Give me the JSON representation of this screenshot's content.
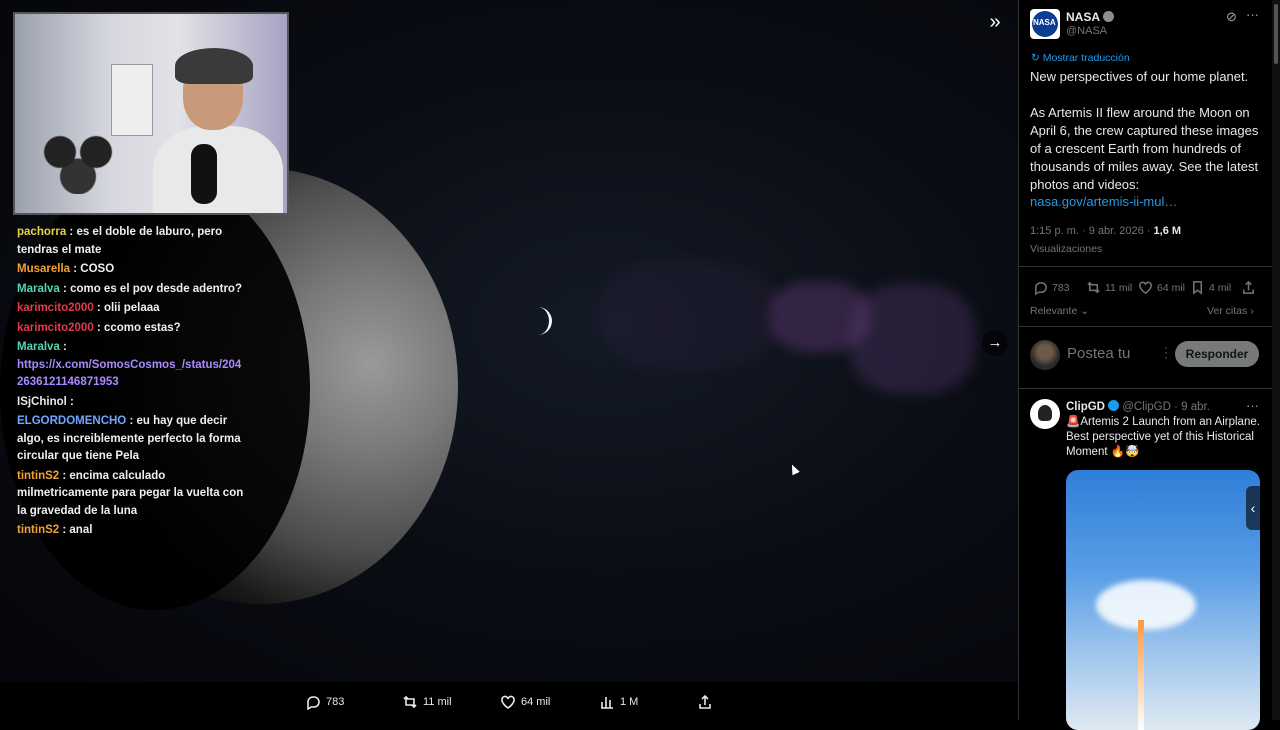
{
  "media_bar": {
    "replies": "783",
    "reposts": "11 mil",
    "likes": "64 mil",
    "views": "1 M"
  },
  "chat": {
    "messages": [
      {
        "user": "pachorra",
        "text": ": es el doble de laburo, pero tendras el mate",
        "user_color": "#e6d34a"
      },
      {
        "user": "Musarella",
        "text": ": COSO",
        "user_color": "#f0a23a"
      },
      {
        "user": "Maralva",
        "text": ": como es el pov desde adentro?",
        "user_color": "#58d3b4"
      },
      {
        "user": "karimcito2000",
        "text": ": olii pelaaa",
        "user_color": "#e23a4a"
      },
      {
        "user": "karimcito2000",
        "text": ": ccomo estas?",
        "user_color": "#e23a4a"
      },
      {
        "user": "Maralva",
        "text": ":",
        "user_color": "#58d3b4",
        "link": "https://x.com/SomosCosmos_/status/2042636121146871953"
      },
      {
        "user": "ISjChinol",
        "text": ":",
        "user_color": "#e7e9ea"
      },
      {
        "user": "ELGORDOMENCHO",
        "text": ": eu hay que decir algo, es increiblemente perfecto la forma circular que tiene Pela",
        "user_color": "#6ea8ff"
      },
      {
        "user": "tintinS2",
        "text": ": encima calculado milmetricamente para pegar la vuelta con la gravedad de la luna",
        "user_color": "#f0a23a"
      },
      {
        "user": "tintinS2",
        "text": ": anal",
        "user_color": "#f0a23a"
      }
    ]
  },
  "tweet": {
    "author": "NASA",
    "handle": "@NASA",
    "translate": "Mostrar traducción",
    "text1": "New perspectives of our home planet.",
    "text2": "As Artemis II flew around the Moon on April 6, the crew captured these images of a crescent Earth from hundreds of thousands of miles away. See the latest photos and videos:",
    "link": "nasa.gov/artemis-ii-mul…",
    "time": "1:15 p. m. · 9 abr. 2026 · ",
    "views_count": "1,6 M",
    "views_label": "Visualizaciones",
    "replies": "783",
    "reposts": "11 mil",
    "likes": "64 mil",
    "bookmarks": "4 mil",
    "sort": "Relevante",
    "quotes": "Ver citas",
    "reply_placeholder": "Postea tu",
    "reply_button": "Responder"
  },
  "reply_tweet": {
    "author": "ClipGD",
    "handle": "@ClipGD",
    "date": "· 9 abr.",
    "text": "🚨Artemis 2 Launch from an Airplane. Best perspective yet of this Historical Moment 🔥🤯"
  }
}
